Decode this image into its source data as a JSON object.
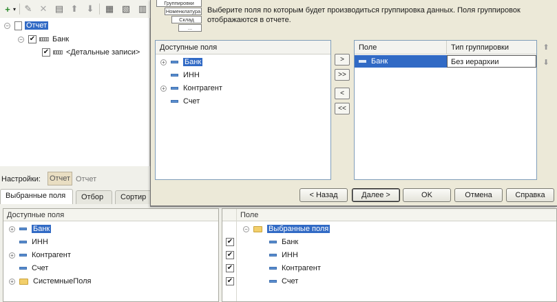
{
  "toolbar": {
    "icons": [
      "add-icon",
      "chevron-down-icon",
      "edit-icon",
      "delete-icon",
      "properties-icon",
      "move-up-icon",
      "move-down-icon",
      "group-icon",
      "ungroup-icon",
      "group-level-icon"
    ]
  },
  "report_tree": {
    "root": "Отчет",
    "group": "Банк",
    "detail": "<Детальные записи>"
  },
  "settings": {
    "label": "Настройки:",
    "button": "Отчет",
    "value": "Отчет"
  },
  "tabs": [
    "Выбранные поля",
    "Отбор",
    "Сортир"
  ],
  "selected_fields_panel": {
    "left_header": "Доступные поля",
    "left_items": [
      "Банк",
      "ИНН",
      "Контрагент",
      "Счет",
      "СистемныеПоля"
    ],
    "right_header": "Поле",
    "right_root": "Выбранные поля",
    "right_items": [
      "Банк",
      "ИНН",
      "Контрагент",
      "Счет"
    ]
  },
  "dialog": {
    "illustration": {
      "title": "Группировки",
      "level1": "Номенклатура",
      "level2": "Склад",
      "level3": "..."
    },
    "info_text": "Выберите поля по которым будет производиться группировка данных. Поля группировок отображаются в отчете.",
    "available": {
      "header": "Доступные поля",
      "items": [
        "Банк",
        "ИНН",
        "Контрагент",
        "Счет"
      ]
    },
    "move_buttons": [
      ">",
      ">>",
      "<",
      "<<"
    ],
    "grouping": {
      "col_field": "Поле",
      "col_type": "Тип группировки",
      "rows": [
        {
          "field": "Банк",
          "type": "Без иерархии"
        }
      ]
    },
    "buttons": {
      "back": "< Назад",
      "next": "Далее >",
      "ok": "OK",
      "cancel": "Отмена",
      "help": "Справка"
    }
  },
  "colors": {
    "selection": "#316ac5",
    "dialog_bg": "#ece9d8",
    "grid_border": "#7f9db9"
  }
}
